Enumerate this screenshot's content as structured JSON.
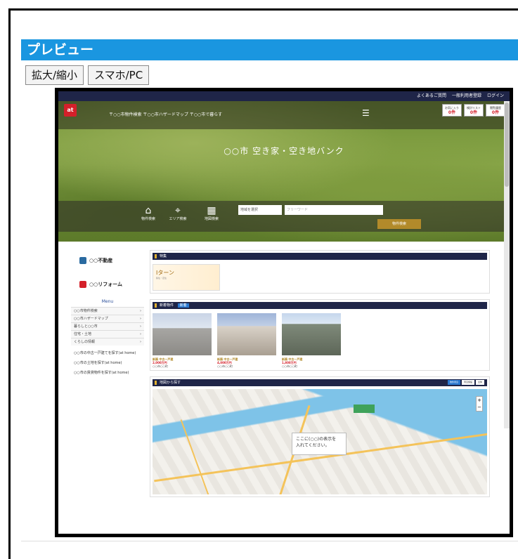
{
  "panel": {
    "title": "プレビュー",
    "buttons": {
      "zoom": "拡大/縮小",
      "device": "スマホ/PC"
    }
  },
  "preview": {
    "top_links": [
      "よくあるご質問",
      "一般利用者登録",
      "ログイン"
    ],
    "logo_text": "at",
    "breadcrumb": "〒○○市物件検索 〒○○市ハザードマップ 〒○○市で暮らす",
    "counters": [
      {
        "label": "お気に入り",
        "value": "0件"
      },
      {
        "label": "検討リスト",
        "value": "0件"
      },
      {
        "label": "閲覧履歴",
        "value": "0件"
      }
    ],
    "hero_title": "○○市 空き家・空き地バンク",
    "search_categories": [
      {
        "icon": "home-icon",
        "label": "物件検索"
      },
      {
        "icon": "map-pin-icon",
        "label": "エリア検索"
      },
      {
        "icon": "building-icon",
        "label": "地図検索"
      }
    ],
    "search_select": "地域を選択",
    "search_keyword_placeholder": "フリーワード",
    "search_button": "物件検索",
    "sidebar": {
      "banners": [
        "○○不動産",
        "○○リフォーム"
      ],
      "menu_title": "Menu",
      "menu_items": [
        "○○市物件検索",
        "○○市ハザードマップ",
        "暮らしと○○市",
        "住宅・土地",
        "くらしの情報"
      ],
      "links": [
        "○○市の中古一戸建てを探す(at home)",
        "○○市の土地を探す(at home)",
        "○○市の賃貸物件を探す(at home)"
      ]
    },
    "sections": {
      "feature_title": "特集",
      "feature_card": "Iターン",
      "feature_sub": "移住・定住",
      "new_title": "新着物件",
      "new_badge": "新着",
      "properties": [
        {
          "title": "新築 中古一戸建",
          "price": "2,000万円",
          "desc": "○○市○○町"
        },
        {
          "title": "新築 中古一戸建",
          "price": "4,000万円",
          "desc": "○○市○○町"
        },
        {
          "title": "新築 中古一戸建",
          "price": "1,800万円",
          "desc": "○○市○○町"
        }
      ],
      "map_title": "地図から探す",
      "map_buttons": [
        "物件周辺",
        "周辺施設",
        "全体"
      ],
      "map_tooltip_line1": "ここに(○○)の表示を",
      "map_tooltip_line2": "入れてください。"
    }
  }
}
